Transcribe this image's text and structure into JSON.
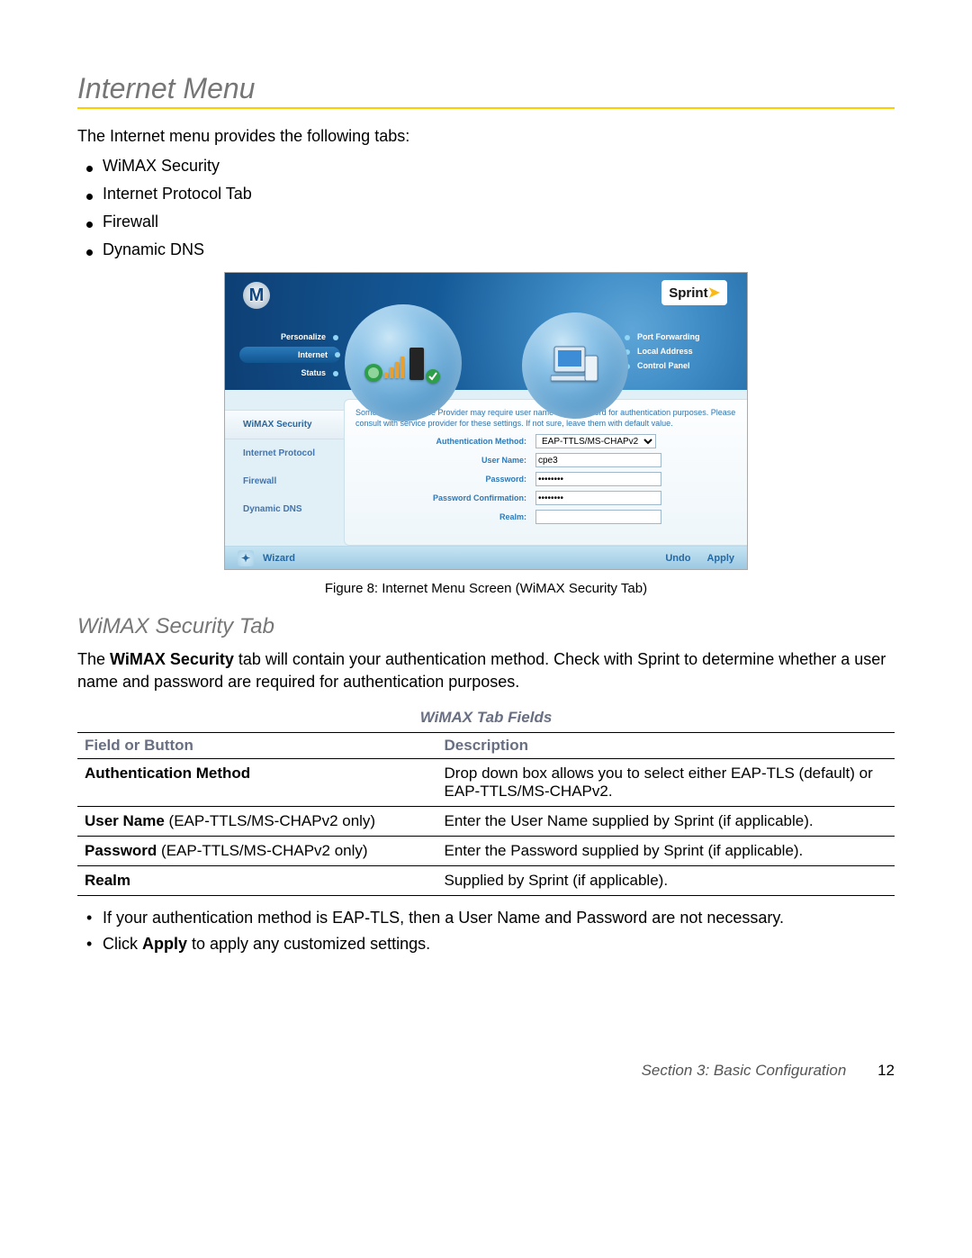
{
  "page": {
    "heading": "Internet Menu",
    "intro": "The Internet menu provides the following tabs:",
    "tabs": [
      "WiMAX Security",
      "Internet Protocol Tab",
      "Firewall",
      "Dynamic DNS"
    ],
    "caption": "Figure 8: Internet Menu Screen (WiMAX Security Tab)",
    "sub_heading": "WiMAX Security Tab",
    "sub_para_before": "The ",
    "sub_para_bold": "WiMAX Security",
    "sub_para_after": " tab will contain your authentication method. Check with Sprint to determine whether a user name and password are required for authentication purposes.",
    "table_title": "WiMAX Tab Fields",
    "table_headers": [
      "Field or Button",
      "Description"
    ],
    "table_rows": [
      {
        "field_bold": "Authentication Method",
        "field_rest": "",
        "desc": "Drop down box allows you to select either EAP-TLS (default) or EAP-TTLS/MS-CHAPv2."
      },
      {
        "field_bold": "User Name",
        "field_rest": " (EAP-TTLS/MS-CHAPv2 only)",
        "desc": "Enter the User Name supplied by Sprint (if applicable)."
      },
      {
        "field_bold": "Password",
        "field_rest": " (EAP-TTLS/MS-CHAPv2 only)",
        "desc": "Enter the Password supplied by Sprint (if applicable)."
      },
      {
        "field_bold": "Realm",
        "field_rest": "",
        "desc": "Supplied by Sprint (if applicable)."
      }
    ],
    "notes": [
      {
        "pre": "If your authentication method is EAP-TLS, then a User Name and Password are not necessary.",
        "bold": "",
        "post": ""
      },
      {
        "pre": "Click ",
        "bold": "Apply",
        "post": " to apply any customized settings."
      }
    ],
    "footer_section": "Section 3: Basic Configuration",
    "footer_page": "12"
  },
  "modem": {
    "brand_logo_letter": "M",
    "sprint_label": "Sprint",
    "nav_left": [
      "Personalize",
      "Internet",
      "Status"
    ],
    "nav_left_active_index": 1,
    "nav_right": [
      "Port Forwarding",
      "Local Address",
      "Control Panel"
    ],
    "side_tabs": [
      "WiMAX Security",
      "Internet Protocol",
      "Firewall",
      "Dynamic DNS"
    ],
    "side_tabs_active_index": 0,
    "form_note": "Some Internet Service Provider may require user name and password for authentication purposes. Please consult with service provider for these settings. If not sure, leave them with default value.",
    "auth_label": "Authentication Method:",
    "auth_value": "EAP-TTLS/MS-CHAPv2",
    "username_label": "User Name:",
    "username_value": "cpe3",
    "password_label": "Password:",
    "password_value": "••••••••",
    "passconf_label": "Password Confirmation:",
    "passconf_value": "••••••••",
    "realm_label": "Realm:",
    "realm_value": "",
    "footer_wizard": "Wizard",
    "footer_undo": "Undo",
    "footer_apply": "Apply"
  }
}
